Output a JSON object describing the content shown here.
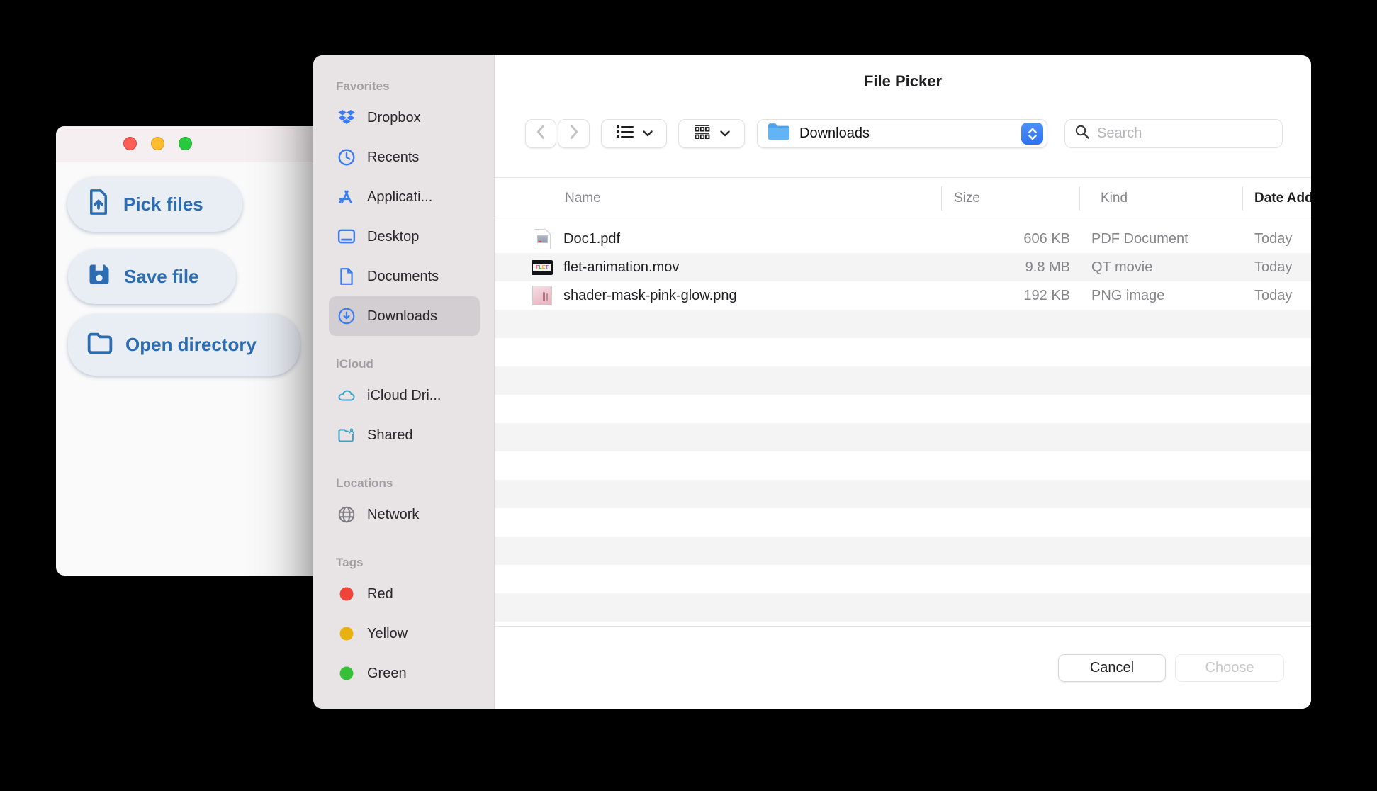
{
  "app_window": {
    "traffic_lights": [
      "close",
      "minimize",
      "zoom"
    ],
    "buttons": [
      {
        "label": "Pick files",
        "icon": "file-upload-icon"
      },
      {
        "label": "Save file",
        "icon": "save-icon"
      },
      {
        "label": "Open directory",
        "icon": "folder-outline-icon"
      }
    ]
  },
  "dialog": {
    "title": "File Picker",
    "toolbar": {
      "back_icon": "chevron-left-icon",
      "forward_icon": "chevron-right-icon",
      "list_view_icon": "list-view-icon",
      "group_view_icon": "group-view-icon",
      "dropdown_icon": "chevron-down-icon",
      "path_selector": {
        "label": "Downloads",
        "icon": "folder-blue-icon",
        "stepper_icon": "up-down-chevrons-icon"
      },
      "search": {
        "placeholder": "Search",
        "icon": "search-icon"
      }
    },
    "sidebar": {
      "sections": [
        {
          "title": "Favorites",
          "items": [
            {
              "label": "Dropbox",
              "icon": "dropbox-icon"
            },
            {
              "label": "Recents",
              "icon": "clock-icon"
            },
            {
              "label": "Applicati...",
              "icon": "appstore-icon"
            },
            {
              "label": "Desktop",
              "icon": "desktop-icon"
            },
            {
              "label": "Documents",
              "icon": "document-icon"
            },
            {
              "label": "Downloads",
              "icon": "download-circle-icon",
              "selected": true
            }
          ]
        },
        {
          "title": "iCloud",
          "items": [
            {
              "label": "iCloud Dri...",
              "icon": "cloud-icon"
            },
            {
              "label": "Shared",
              "icon": "shared-folder-icon"
            }
          ]
        },
        {
          "title": "Locations",
          "items": [
            {
              "label": "Network",
              "icon": "globe-icon"
            }
          ]
        },
        {
          "title": "Tags",
          "items": [
            {
              "label": "Red",
              "icon": "tag-red-icon"
            },
            {
              "label": "Yellow",
              "icon": "tag-yellow-icon"
            },
            {
              "label": "Green",
              "icon": "tag-green-icon"
            }
          ]
        }
      ]
    },
    "table": {
      "columns": [
        "Name",
        "Size",
        "Kind",
        "Date Added"
      ],
      "rows": [
        {
          "name": "Doc1.pdf",
          "size": "606 KB",
          "kind": "PDF Document",
          "date": "Today",
          "icon": "pdf-file-icon"
        },
        {
          "name": "flet-animation.mov",
          "size": "9.8 MB",
          "kind": "QT movie",
          "date": "Today",
          "icon": "movie-file-icon"
        },
        {
          "name": "shader-mask-pink-glow.png",
          "size": "192 KB",
          "kind": "PNG image",
          "date": "Today",
          "icon": "image-file-icon"
        }
      ]
    },
    "footer": {
      "cancel_label": "Cancel",
      "choose_label": "Choose"
    }
  },
  "colors": {
    "accent_blue": "#3478f6",
    "icloud_teal": "#3aa3c9",
    "tag_red": "#ee4439",
    "tag_yellow": "#e8b112",
    "tag_green": "#36c03a",
    "sidebar_bg": "#e8e3e5",
    "selected_bg": "#d3ced1",
    "stripe_gray": "#f4f4f5",
    "pill_text": "#2b6cb3"
  }
}
